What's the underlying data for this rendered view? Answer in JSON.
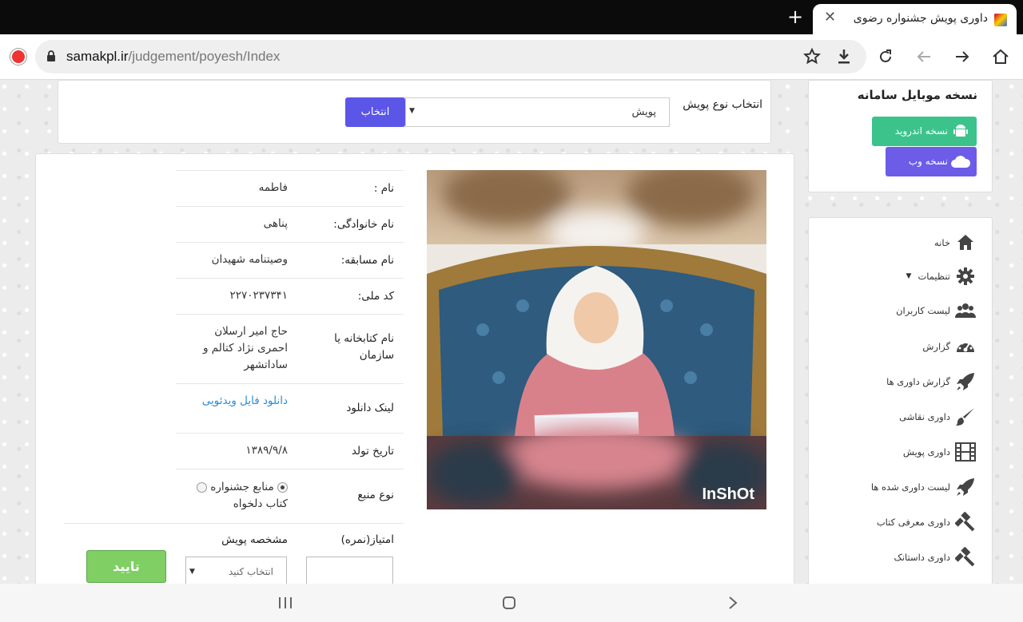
{
  "browser": {
    "tab_title": "داوری پویش جشنواره رضوی",
    "url_domain": "samakpl.ir",
    "url_path": "/judgement/poyesh/Index"
  },
  "mobile": {
    "title": "نسخه موبایل سامانه",
    "android_label": "نسخه اندروید",
    "web_label": "نسخه وب"
  },
  "nav": {
    "items": [
      {
        "label": "خانه",
        "icon": "home-icon"
      },
      {
        "label": "تنظیمات",
        "icon": "gear-icon"
      },
      {
        "label": "لیست کاربران",
        "icon": "users-icon"
      },
      {
        "label": "گزارش",
        "icon": "dashboard-icon"
      },
      {
        "label": "گزارش داوری ها",
        "icon": "rocket-icon"
      },
      {
        "label": "داوری نقاشی",
        "icon": "brush-icon"
      },
      {
        "label": "داوری پویش",
        "icon": "film-icon"
      },
      {
        "label": "لیست داوری شده ها",
        "icon": "rocket-icon"
      },
      {
        "label": "داوری معرفی کتاب",
        "icon": "gavel-icon"
      },
      {
        "label": "داوری داستانک",
        "icon": "gavel-icon"
      }
    ]
  },
  "selector": {
    "label": "انتخاب نوع پویش",
    "value": "پویش",
    "button": "انتخاب"
  },
  "details": {
    "name_label": "نام :",
    "name_value": "فاطمه",
    "family_label": "نام خانوادگی:",
    "family_value": "پناهی",
    "contest_label": "نام مسابقه:",
    "contest_value": "وصیتنامه شهیدان",
    "nid_label": "کد ملی:",
    "nid_value": "۲۲۷۰۲۳۷۳۴۱",
    "library_label": "نام کتابخانه یا سازمان",
    "library_value": "حاج امیر ارسلان احمری نژاد کتالم و ساداتشهر",
    "download_label": "لینک دانلود",
    "download_value": "دانلود فایل ویدئویی",
    "birth_label": "تاریخ تولد",
    "birth_value": "۱۳۸۹/۹/۸",
    "source_label": "نوع منبع",
    "source_option1": "منابع جشنواره",
    "source_option2": "کتاب دلخواه"
  },
  "scoring": {
    "score_label": "امتیاز(نمره)",
    "spec_label": "مشخصه پویش",
    "spec_placeholder": "انتخاب کنید",
    "confirm": "تایید"
  },
  "video": {
    "watermark": "InShOt"
  }
}
